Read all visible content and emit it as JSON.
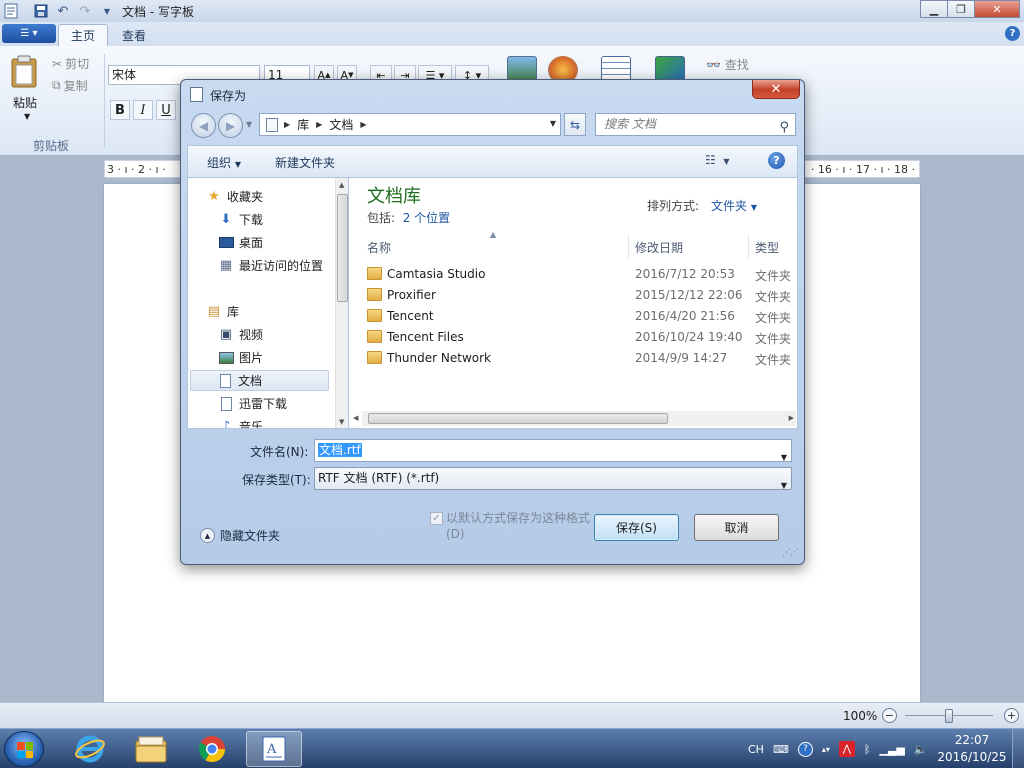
{
  "app": {
    "title": "文档 - 写字板",
    "tabs": [
      "主页",
      "查看"
    ],
    "ribbon": {
      "paste_label": "粘贴",
      "cut_label": "剪切",
      "copy_label": "复制",
      "clipboard_group": "剪贴板",
      "font_name": "宋体",
      "font_size": "11",
      "bold": "B",
      "italic": "I",
      "underline": "U",
      "find_label": "查找"
    },
    "ruler": {
      "left": "3 · ı · 2 · ı ·",
      "right": "· 16 · ı · 17 · ı · 18 ·"
    },
    "status": {
      "zoom": "100%"
    }
  },
  "dialog": {
    "title": "保存为",
    "breadcrumb": [
      "库",
      "文档"
    ],
    "search_placeholder": "搜索 文档",
    "toolbar": {
      "organize": "组织",
      "new_folder": "新建文件夹"
    },
    "nav": {
      "items": [
        {
          "label": "收藏夹",
          "icon": "star-icon"
        },
        {
          "label": "下载",
          "icon": "download-folder-icon"
        },
        {
          "label": "桌面",
          "icon": "desktop-icon"
        },
        {
          "label": "最近访问的位置",
          "icon": "recent-places-icon"
        },
        {
          "label": "库",
          "icon": "library-icon"
        },
        {
          "label": "视频",
          "icon": "video-icon"
        },
        {
          "label": "图片",
          "icon": "pictures-icon"
        },
        {
          "label": "文档",
          "icon": "documents-icon"
        },
        {
          "label": "迅雷下载",
          "icon": "thunder-download-icon"
        },
        {
          "label": "音乐",
          "icon": "music-icon"
        }
      ]
    },
    "library": {
      "title": "文档库",
      "includes_label": "包括:",
      "includes_link": "2 个位置",
      "sort_label": "排列方式:",
      "sort_value": "文件夹"
    },
    "columns": {
      "name": "名称",
      "modified": "修改日期",
      "type": "类型"
    },
    "files": [
      {
        "name": "Camtasia Studio",
        "modified": "2016/7/12 20:53",
        "type": "文件夹"
      },
      {
        "name": "Proxifier",
        "modified": "2015/12/12 22:06",
        "type": "文件夹"
      },
      {
        "name": "Tencent",
        "modified": "2016/4/20 21:56",
        "type": "文件夹"
      },
      {
        "name": "Tencent Files",
        "modified": "2016/10/24 19:40",
        "type": "文件夹"
      },
      {
        "name": "Thunder Network",
        "modified": "2014/9/9 14:27",
        "type": "文件夹"
      }
    ],
    "filename_label": "文件名(N):",
    "filename_value": "文档.rtf",
    "filetype_label": "保存类型(T):",
    "filetype_value": "RTF 文档 (RTF) (*.rtf)",
    "hide_folders": "隐藏文件夹",
    "default_format_label": "以默认方式保存为这种格式(D)",
    "save_button": "保存(S)",
    "cancel_button": "取消"
  },
  "taskbar": {
    "ime": "CH",
    "time": "22:07",
    "date": "2016/10/25"
  }
}
